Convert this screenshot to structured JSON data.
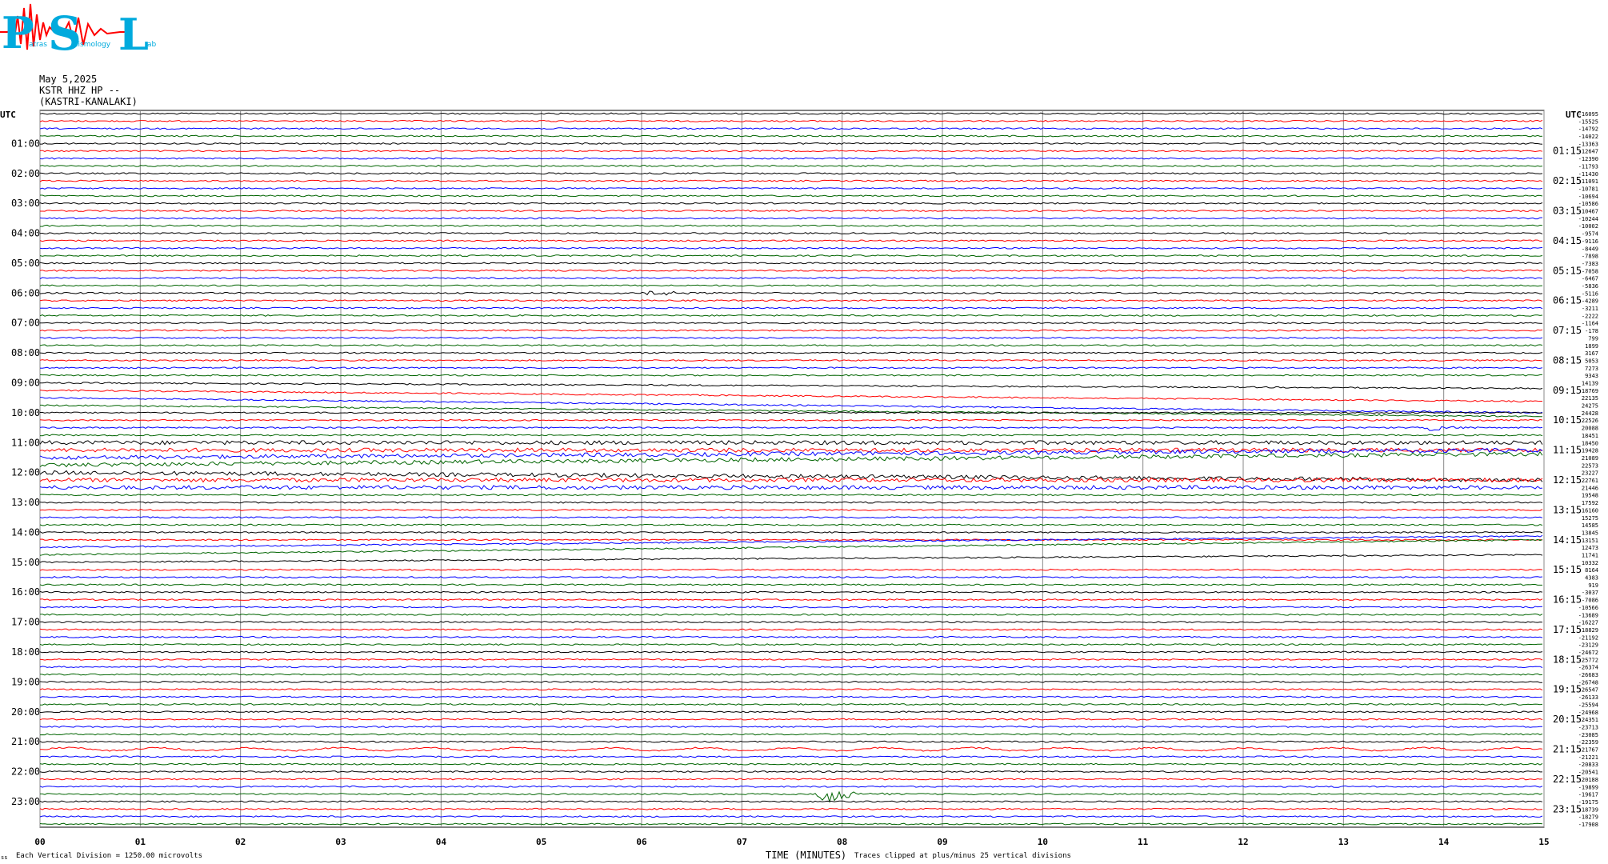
{
  "logo": {
    "letters": [
      "P",
      "S",
      "L"
    ],
    "words": [
      "atras",
      "eismology",
      "ab"
    ]
  },
  "header": {
    "date": "May 5,2025",
    "station": "KSTR HHZ HP --",
    "location": "(KASTRI-KANALAKI)"
  },
  "left_title": "UTC",
  "right_title": "UTC",
  "left_hour_labels": [
    "01:00",
    "02:00",
    "03:00",
    "04:00",
    "05:00",
    "06:00",
    "07:00",
    "08:00",
    "09:00",
    "10:00",
    "11:00",
    "12:00",
    "13:00",
    "14:00",
    "15:00",
    "16:00",
    "17:00",
    "18:00",
    "19:00",
    "20:00",
    "21:00",
    "22:00",
    "23:00"
  ],
  "right_hour_labels": [
    "01:15",
    "02:15",
    "03:15",
    "04:15",
    "05:15",
    "06:15",
    "07:15",
    "08:15",
    "09:15",
    "10:15",
    "11:15",
    "12:15",
    "13:15",
    "14:15",
    "15:15",
    "16:15",
    "17:15",
    "18:15",
    "19:15",
    "20:15",
    "21:15",
    "22:15",
    "23:15"
  ],
  "footer": {
    "left_mark": "ss",
    "scale_note": "Each Vertical Division = 1250.00 microvolts",
    "xlabel": "TIME (MINUTES)",
    "clip_note": "Traces clipped at plus/minus 25 vertical divisions"
  },
  "colors": {
    "trace_cycle": [
      "#000000",
      "#ff0000",
      "#0000ff",
      "#006400"
    ],
    "grid": "#888888",
    "logo_red": "#ff0000",
    "logo_cyan": "#00aadd"
  },
  "chart_data": {
    "type": "line",
    "xlabel": "TIME (MINUTES)",
    "x_ticks": [
      "00",
      "01",
      "02",
      "03",
      "04",
      "05",
      "06",
      "07",
      "08",
      "09",
      "10",
      "11",
      "12",
      "13",
      "14",
      "15"
    ],
    "xlim": [
      0,
      15
    ],
    "rows_per_hour": 4,
    "row_count": 96,
    "row_offsets": [
      -16095,
      -15525,
      -14792,
      -14022,
      -13363,
      -12647,
      -12390,
      -11793,
      -11430,
      -11091,
      -10781,
      -10694,
      -10586,
      -10467,
      -10244,
      -10002,
      -9574,
      -9116,
      -8449,
      -7898,
      -7383,
      -7058,
      -6467,
      -5836,
      -5116,
      -4289,
      -3211,
      -2222,
      -1164,
      -178,
      799,
      1899,
      3167,
      5053,
      7273,
      9343,
      14139,
      18769,
      22135,
      24275,
      24428,
      22526,
      20088,
      18451,
      18450,
      19428,
      21089,
      22573,
      23227,
      22761,
      21446,
      19548,
      17592,
      16160,
      15275,
      14585,
      13845,
      13151,
      12473,
      11741,
      10332,
      8164,
      4383,
      919,
      -3037,
      -7086,
      -10566,
      -13689,
      -16227,
      -18829,
      -21192,
      -23129,
      -24672,
      -25772,
      -26374,
      -26683,
      -26748,
      -26547,
      -26133,
      -25594,
      -24968,
      -24351,
      -23713,
      -23085,
      -22359,
      -21767,
      -21221,
      -20833,
      -20541,
      -20188,
      -19899,
      -19617,
      -19175,
      -18739,
      -18279,
      -17908
    ],
    "events": [
      {
        "row": 24,
        "minute": 6.1,
        "note": "small burst near 07:00"
      },
      {
        "row": 42,
        "minute": 13.9,
        "note": "burst near 11:15"
      },
      {
        "row": 91,
        "minute": 7.85,
        "note": "earthquake signal near 23:15"
      }
    ],
    "scale_microvolts_per_division": 1250.0,
    "clip_divisions": 25
  }
}
